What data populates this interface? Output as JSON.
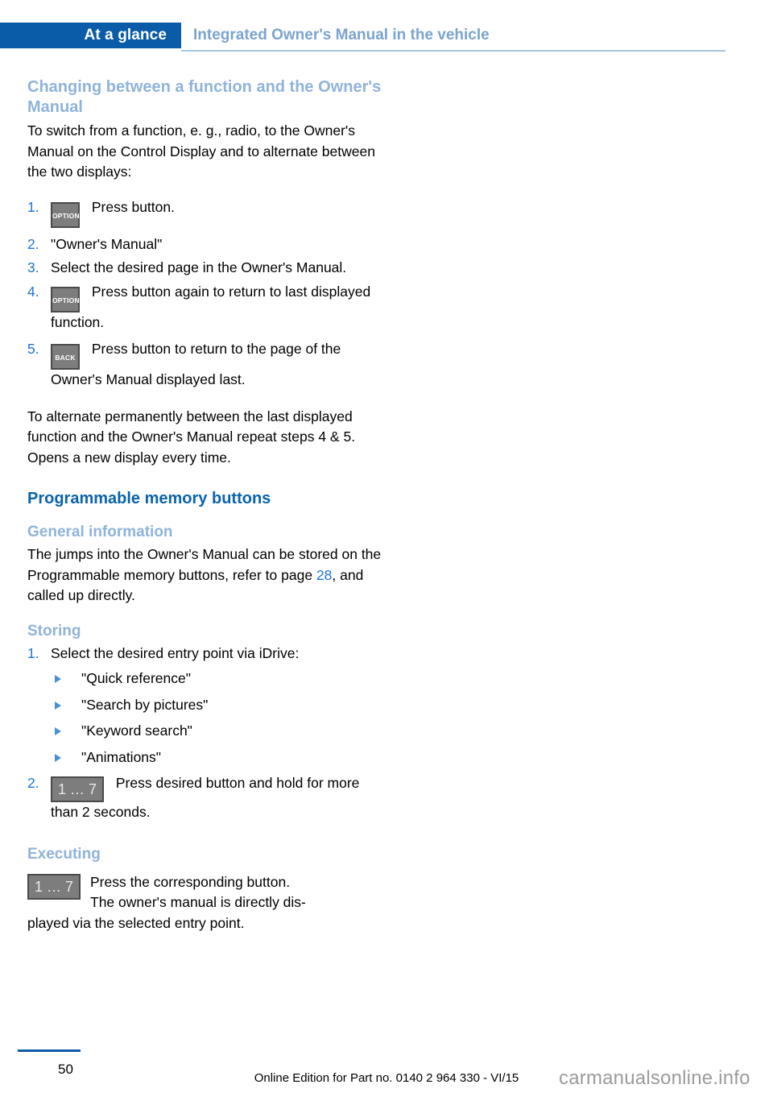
{
  "header": {
    "tab_label": "At a glance",
    "title": "Integrated Owner's Manual in the vehicle"
  },
  "sections": [
    {
      "heading": "Changing between a function and the Owner's Manual",
      "intro": "To switch from a function, e. g., radio, to the Owner's Manual on the Control Display and to alternate between the two displays:",
      "steps": [
        {
          "num": "1.",
          "icon": "OPTION",
          "text": "Press button."
        },
        {
          "num": "2.",
          "icon": "",
          "text": "\"Owner's Manual\""
        },
        {
          "num": "3.",
          "icon": "",
          "text": "Select the desired page in the Owner's Manual."
        },
        {
          "num": "4.",
          "icon": "OPTION",
          "text": "Press button again to return to last displayed function."
        },
        {
          "num": "5.",
          "icon": "BACK",
          "text": "Press button to return to the page of the Owner's Manual displayed last."
        }
      ],
      "outro": "To alternate permanently between the last displayed function and the Owner's Manual repeat steps 4 & 5. Opens a new display every time."
    }
  ],
  "programmable": {
    "heading": "Programmable memory buttons",
    "general": {
      "heading": "General information",
      "text_before": "The jumps into the Owner's Manual can be stored on the Programmable memory buttons, refer to page ",
      "page_ref": "28",
      "text_after": ", and called up directly."
    },
    "storing": {
      "heading": "Storing",
      "step1_num": "1.",
      "step1_text": "Select the desired entry point via iDrive:",
      "options": [
        "\"Quick reference\"",
        "\"Search by pictures\"",
        "\"Keyword search\"",
        "\"Animations\""
      ],
      "step2_num": "2.",
      "step2_icon": "1 … 7",
      "step2_text": "Press desired button and hold for more than 2 seconds."
    },
    "executing": {
      "heading": "Executing",
      "icon": "1 … 7",
      "line1": "Press the corresponding button.",
      "line2": "The owner's manual is directly dis-",
      "line3": "played via the selected entry point."
    }
  },
  "footer": {
    "page_number": "50",
    "edition": "Online Edition for Part no. 0140 2 964 330 - VI/15",
    "watermark": "carmanualsonline.info"
  },
  "colors": {
    "tab_blue": "#0a5ba8",
    "heading_light_blue": "#8fb3db",
    "heading_dark_blue": "#0a63ad",
    "xref_blue": "#1c74d4",
    "glyph_gray": "#7d7d7d"
  }
}
